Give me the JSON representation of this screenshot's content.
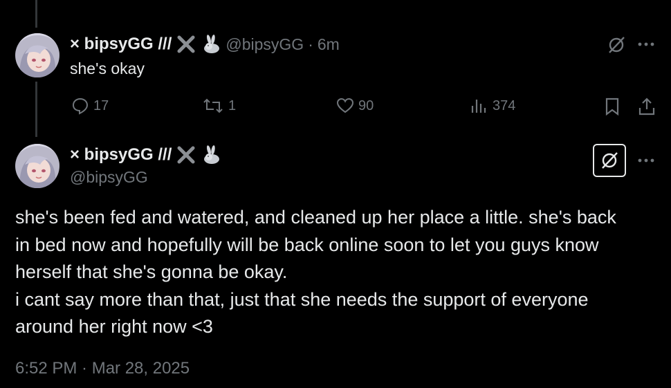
{
  "reply": {
    "display_name": "× bipsyGG ///",
    "handle": "@bipsyGG",
    "separator": "·",
    "time_ago": "6m",
    "text": "she's okay",
    "actions": {
      "replies": "17",
      "reposts": "1",
      "likes": "90",
      "views": "374"
    }
  },
  "main_post": {
    "display_name": "× bipsyGG ///",
    "handle": "@bipsyGG",
    "text_lines": [
      "she's been fed and watered, and cleaned up her place a little. she's back",
      "in bed now and hopefully will be back online soon to let you guys know",
      "herself that she's gonna be okay.",
      "i cant say more than that, just that she needs the support of everyone",
      "around her right now <3"
    ],
    "timestamp": "6:52 PM · Mar 28, 2025"
  },
  "icons": {
    "name_badges": [
      "x-mark-icon",
      "rabbit-icon"
    ],
    "reply_icon": "speech-bubble-icon",
    "repost_icon": "repost-arrows-icon",
    "like_icon": "heart-icon",
    "views_icon": "bar-chart-icon",
    "bookmark_icon": "bookmark-icon",
    "share_icon": "share-icon",
    "grok_icon": "grok-slash-circle-icon",
    "more_icon": "more-dots-icon"
  },
  "colors": {
    "background": "#000000",
    "text": "#e7e9ea",
    "muted": "#71767b"
  }
}
